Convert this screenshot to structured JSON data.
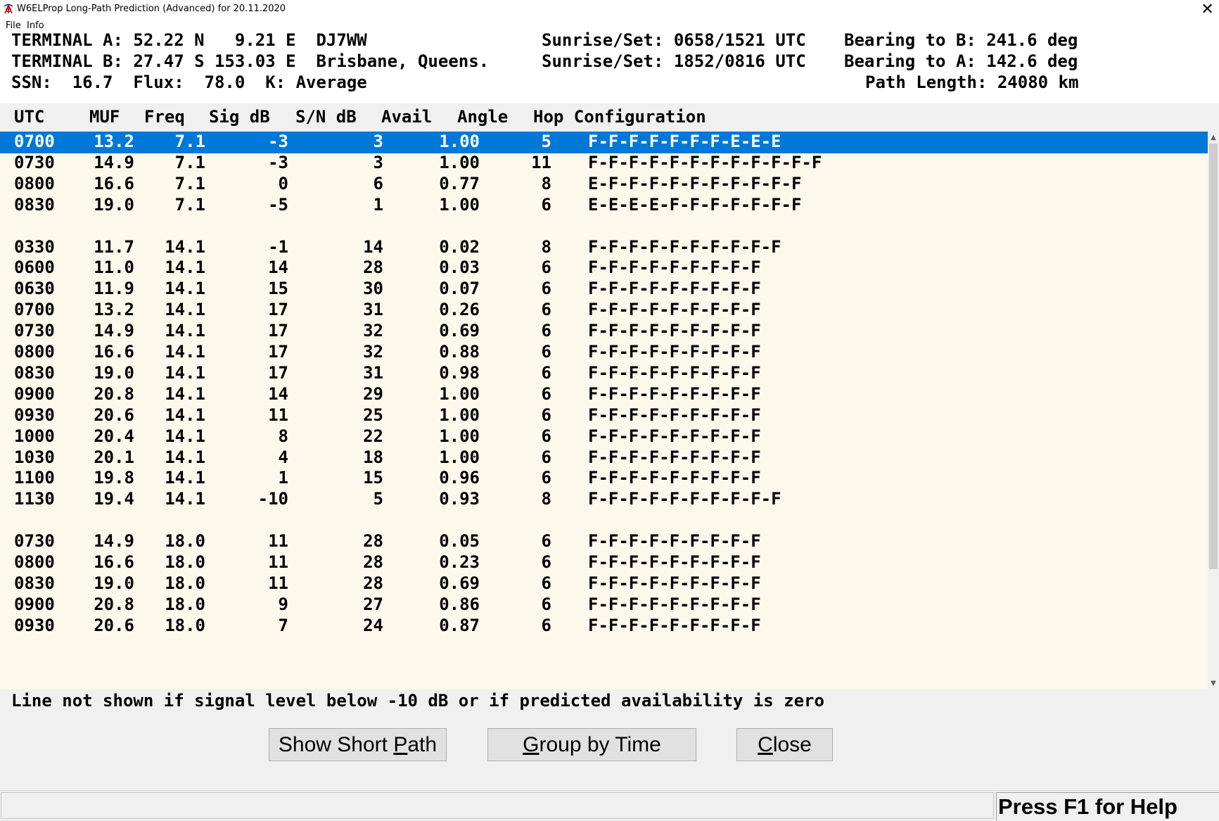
{
  "window": {
    "title": "W6ELProp Long-Path Prediction (Advanced) for 20.11.2020",
    "close_glyph": "✕",
    "icon": "antenna-icon"
  },
  "menu": [
    "File",
    "Info"
  ],
  "header": {
    "line1_left": "TERMINAL A: 52.22 N   9.21 E  DJ7WW",
    "line1_mid": "Sunrise/Set: 0658/1521 UTC",
    "line1_right": "Bearing to B: 241.6 deg",
    "line2_left": "TERMINAL B: 27.47 S 153.03 E  Brisbane, Queens.",
    "line2_mid": "Sunrise/Set: 1852/0816 UTC",
    "line2_right": "Bearing to A: 142.6 deg",
    "line3_left": "SSN:  16.7  Flux:  78.0  K: Average",
    "line3_right": "Path Length: 24080 km"
  },
  "columns": [
    "UTC",
    "MUF",
    "Freq",
    "Sig dB",
    "S/N dB",
    "Avail",
    "Angle",
    "Hop Configuration"
  ],
  "rows": [
    {
      "utc": "0700",
      "muf": "13.2",
      "freq": "7.1",
      "sig": "-3",
      "sn": "3",
      "avail": "1.00",
      "angle": "5",
      "hop": "F-F-F-F-F-F-F-E-E-E",
      "selected": true
    },
    {
      "utc": "0730",
      "muf": "14.9",
      "freq": "7.1",
      "sig": "-3",
      "sn": "3",
      "avail": "1.00",
      "angle": "11",
      "hop": "F-F-F-F-F-F-F-F-F-F-F-F"
    },
    {
      "utc": "0800",
      "muf": "16.6",
      "freq": "7.1",
      "sig": "0",
      "sn": "6",
      "avail": "0.77",
      "angle": "8",
      "hop": "E-F-F-F-F-F-F-F-F-F-F"
    },
    {
      "utc": "0830",
      "muf": "19.0",
      "freq": "7.1",
      "sig": "-5",
      "sn": "1",
      "avail": "1.00",
      "angle": "6",
      "hop": "E-E-E-E-F-F-F-F-F-F-F"
    },
    {
      "blank": true
    },
    {
      "utc": "0330",
      "muf": "11.7",
      "freq": "14.1",
      "sig": "-1",
      "sn": "14",
      "avail": "0.02",
      "angle": "8",
      "hop": "F-F-F-F-F-F-F-F-F-F"
    },
    {
      "utc": "0600",
      "muf": "11.0",
      "freq": "14.1",
      "sig": "14",
      "sn": "28",
      "avail": "0.03",
      "angle": "6",
      "hop": "F-F-F-F-F-F-F-F-F"
    },
    {
      "utc": "0630",
      "muf": "11.9",
      "freq": "14.1",
      "sig": "15",
      "sn": "30",
      "avail": "0.07",
      "angle": "6",
      "hop": "F-F-F-F-F-F-F-F-F"
    },
    {
      "utc": "0700",
      "muf": "13.2",
      "freq": "14.1",
      "sig": "17",
      "sn": "31",
      "avail": "0.26",
      "angle": "6",
      "hop": "F-F-F-F-F-F-F-F-F"
    },
    {
      "utc": "0730",
      "muf": "14.9",
      "freq": "14.1",
      "sig": "17",
      "sn": "32",
      "avail": "0.69",
      "angle": "6",
      "hop": "F-F-F-F-F-F-F-F-F"
    },
    {
      "utc": "0800",
      "muf": "16.6",
      "freq": "14.1",
      "sig": "17",
      "sn": "32",
      "avail": "0.88",
      "angle": "6",
      "hop": "F-F-F-F-F-F-F-F-F"
    },
    {
      "utc": "0830",
      "muf": "19.0",
      "freq": "14.1",
      "sig": "17",
      "sn": "31",
      "avail": "0.98",
      "angle": "6",
      "hop": "F-F-F-F-F-F-F-F-F"
    },
    {
      "utc": "0900",
      "muf": "20.8",
      "freq": "14.1",
      "sig": "14",
      "sn": "29",
      "avail": "1.00",
      "angle": "6",
      "hop": "F-F-F-F-F-F-F-F-F"
    },
    {
      "utc": "0930",
      "muf": "20.6",
      "freq": "14.1",
      "sig": "11",
      "sn": "25",
      "avail": "1.00",
      "angle": "6",
      "hop": "F-F-F-F-F-F-F-F-F"
    },
    {
      "utc": "1000",
      "muf": "20.4",
      "freq": "14.1",
      "sig": "8",
      "sn": "22",
      "avail": "1.00",
      "angle": "6",
      "hop": "F-F-F-F-F-F-F-F-F"
    },
    {
      "utc": "1030",
      "muf": "20.1",
      "freq": "14.1",
      "sig": "4",
      "sn": "18",
      "avail": "1.00",
      "angle": "6",
      "hop": "F-F-F-F-F-F-F-F-F"
    },
    {
      "utc": "1100",
      "muf": "19.8",
      "freq": "14.1",
      "sig": "1",
      "sn": "15",
      "avail": "0.96",
      "angle": "6",
      "hop": "F-F-F-F-F-F-F-F-F"
    },
    {
      "utc": "1130",
      "muf": "19.4",
      "freq": "14.1",
      "sig": "-10",
      "sn": "5",
      "avail": "0.93",
      "angle": "8",
      "hop": "F-F-F-F-F-F-F-F-F-F"
    },
    {
      "blank": true
    },
    {
      "utc": "0730",
      "muf": "14.9",
      "freq": "18.0",
      "sig": "11",
      "sn": "28",
      "avail": "0.05",
      "angle": "6",
      "hop": "F-F-F-F-F-F-F-F-F"
    },
    {
      "utc": "0800",
      "muf": "16.6",
      "freq": "18.0",
      "sig": "11",
      "sn": "28",
      "avail": "0.23",
      "angle": "6",
      "hop": "F-F-F-F-F-F-F-F-F"
    },
    {
      "utc": "0830",
      "muf": "19.0",
      "freq": "18.0",
      "sig": "11",
      "sn": "28",
      "avail": "0.69",
      "angle": "6",
      "hop": "F-F-F-F-F-F-F-F-F"
    },
    {
      "utc": "0900",
      "muf": "20.8",
      "freq": "18.0",
      "sig": "9",
      "sn": "27",
      "avail": "0.86",
      "angle": "6",
      "hop": "F-F-F-F-F-F-F-F-F"
    },
    {
      "utc": "0930",
      "muf": "20.6",
      "freq": "18.0",
      "sig": "7",
      "sn": "24",
      "avail": "0.87",
      "angle": "6",
      "hop": "F-F-F-F-F-F-F-F-F"
    }
  ],
  "note": "Line not shown if signal level below -10 dB or if predicted availability is zero",
  "buttons": {
    "short_path": {
      "pre": "Show Short ",
      "key": "P",
      "post": "ath"
    },
    "group_by_time": {
      "pre": "",
      "key": "G",
      "post": "roup by Time"
    },
    "close": {
      "pre": "",
      "key": "C",
      "post": "lose"
    }
  },
  "status": {
    "help": "Press F1 for Help"
  },
  "colors": {
    "selection": "#0078d7",
    "list_bg": "#fdf8ec"
  }
}
